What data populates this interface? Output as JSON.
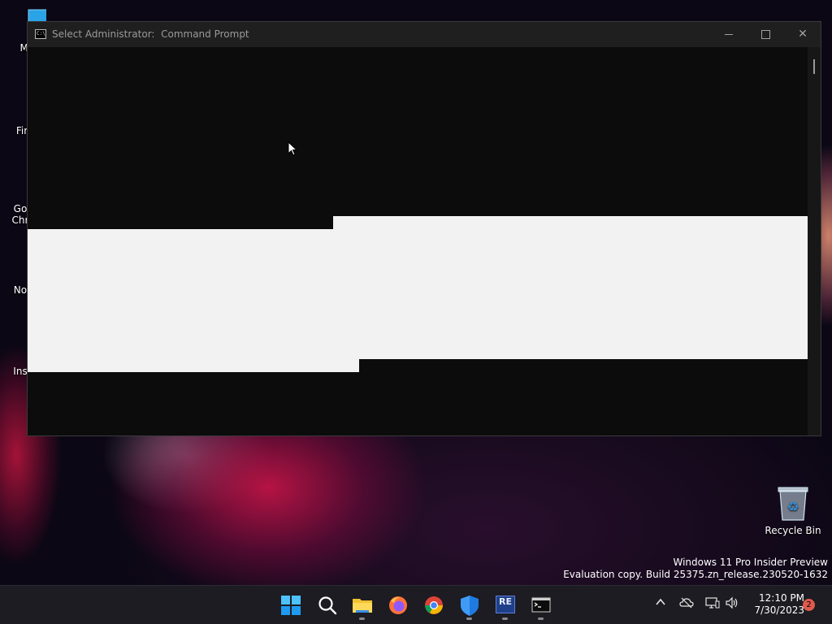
{
  "desktop": {
    "icons": [
      {
        "label": "My Co",
        "icon": "computer-icon"
      },
      {
        "label": "Fir",
        "icon": "firefox-icon"
      },
      {
        "label": "Go\nChr",
        "icon": "chrome-icon"
      },
      {
        "label": "Note",
        "icon": "notepad-icon"
      },
      {
        "label": "Ins",
        "icon": "installer-icon"
      }
    ],
    "recycle_bin": {
      "label": "Recycle Bin",
      "icon": "recycle-bin-icon"
    },
    "watermark": {
      "line1": "Windows 11 Pro Insider Preview",
      "line2": "Evaluation copy. Build 25375.zn_release.230520-1632"
    }
  },
  "window": {
    "title": "Select Administrator:  Command Prompt",
    "icon": "cmd-icon",
    "colors": {
      "console_bg": "#0c0c0c",
      "selection": "#f2f2f2",
      "titlebar_bg": "#1f1f1f"
    },
    "controls": {
      "minimize": "—",
      "maximize": "☐",
      "close": "✕"
    }
  },
  "taskbar": {
    "apps": [
      {
        "name": "start",
        "icon": "windows-start-icon",
        "running": false
      },
      {
        "name": "search",
        "icon": "search-icon",
        "running": false
      },
      {
        "name": "file-explorer",
        "icon": "folder-icon",
        "running": true
      },
      {
        "name": "firefox",
        "icon": "firefox-icon",
        "running": false
      },
      {
        "name": "chrome",
        "icon": "chrome-icon",
        "running": false
      },
      {
        "name": "defender",
        "icon": "shield-icon",
        "running": true
      },
      {
        "name": "re-app",
        "icon": "re-icon",
        "running": true,
        "text": "RE"
      },
      {
        "name": "command-prompt",
        "icon": "terminal-icon",
        "running": true
      }
    ],
    "tray": {
      "overflow": "^",
      "time": "12:10 PM",
      "date": "7/30/2023",
      "notifications": "2"
    }
  }
}
